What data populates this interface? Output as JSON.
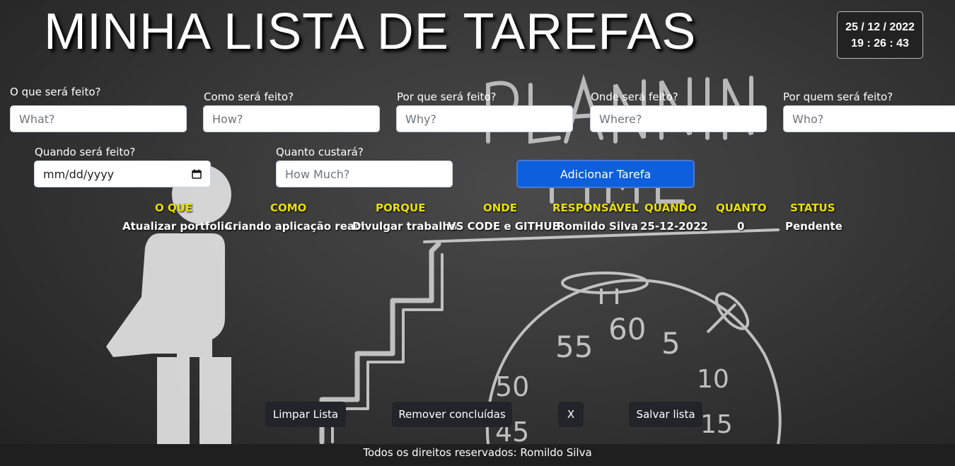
{
  "header": {
    "title": "MINHA LISTA DE TAREFAS"
  },
  "clock": {
    "date": "25 / 12 / 2022",
    "time": "19 : 26 : 43"
  },
  "form": {
    "what": {
      "label": "O que será feito?",
      "placeholder": "What?"
    },
    "how": {
      "label": "Como será feito?",
      "placeholder": "How?"
    },
    "why": {
      "label": "Por que será feito?",
      "placeholder": "Why?"
    },
    "where": {
      "label": "Onde será feito?",
      "placeholder": "Where?"
    },
    "who": {
      "label": "Por quem será feito?",
      "placeholder": "Who?"
    },
    "when": {
      "label": "Quando será feito?",
      "placeholder": "mm/dd/yyyy"
    },
    "how_much": {
      "label": "Quanto custará?",
      "placeholder": "How Much?"
    },
    "add_button": "Adicionar Tarefa"
  },
  "table": {
    "headers": [
      "O QUE",
      "COMO",
      "PORQUE",
      "ONDE",
      "RESPONSÁVEL",
      "QUANDO",
      "QUANTO",
      "STATUS"
    ],
    "rows": [
      [
        "Atualizar portfolio",
        "Criando aplicação react",
        "Divulgar trabalho",
        "VS CODE e GITHUB",
        "Romildo Silva",
        "25-12-2022",
        "0",
        "Pendente"
      ]
    ]
  },
  "actions": {
    "clear": "Limpar Lista",
    "remove_done": "Remover concluídas",
    "close": "X",
    "save": "Salvar lista"
  },
  "footer": {
    "text": "Todos os direitos reservados: Romildo Silva"
  },
  "colors": {
    "primary_button": "#0d5fde",
    "header_text": "#e8e000",
    "dark_button": "#212529"
  }
}
